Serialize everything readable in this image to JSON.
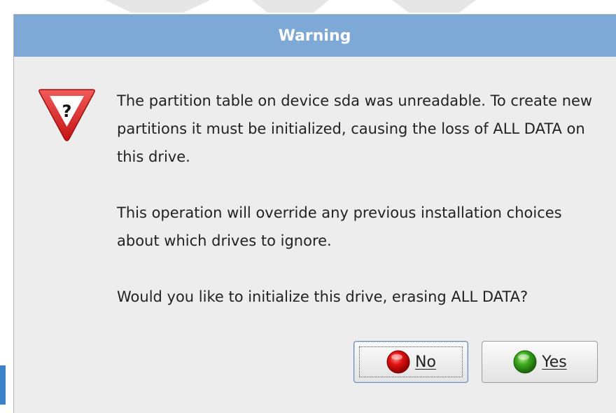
{
  "dialog": {
    "title": "Warning",
    "icon": "warning-question-icon",
    "message": [
      "The partition table on device sda was unreadable. To create new partitions it must be initialized, causing the loss of ALL DATA on this drive.",
      "This operation will override any previous installation choices about which drives to ignore.",
      "Would you like to initialize this drive, erasing ALL DATA?"
    ]
  },
  "buttons": {
    "no": {
      "label": "No",
      "icon": "red-circle-icon"
    },
    "yes": {
      "label": "Yes",
      "icon": "green-circle-icon"
    }
  },
  "colors": {
    "titlebar": "#7ea8d6",
    "dialog_bg": "#ededed",
    "warning_red": "#d92020",
    "no_red": "#e01010",
    "yes_green": "#3aa81e"
  }
}
